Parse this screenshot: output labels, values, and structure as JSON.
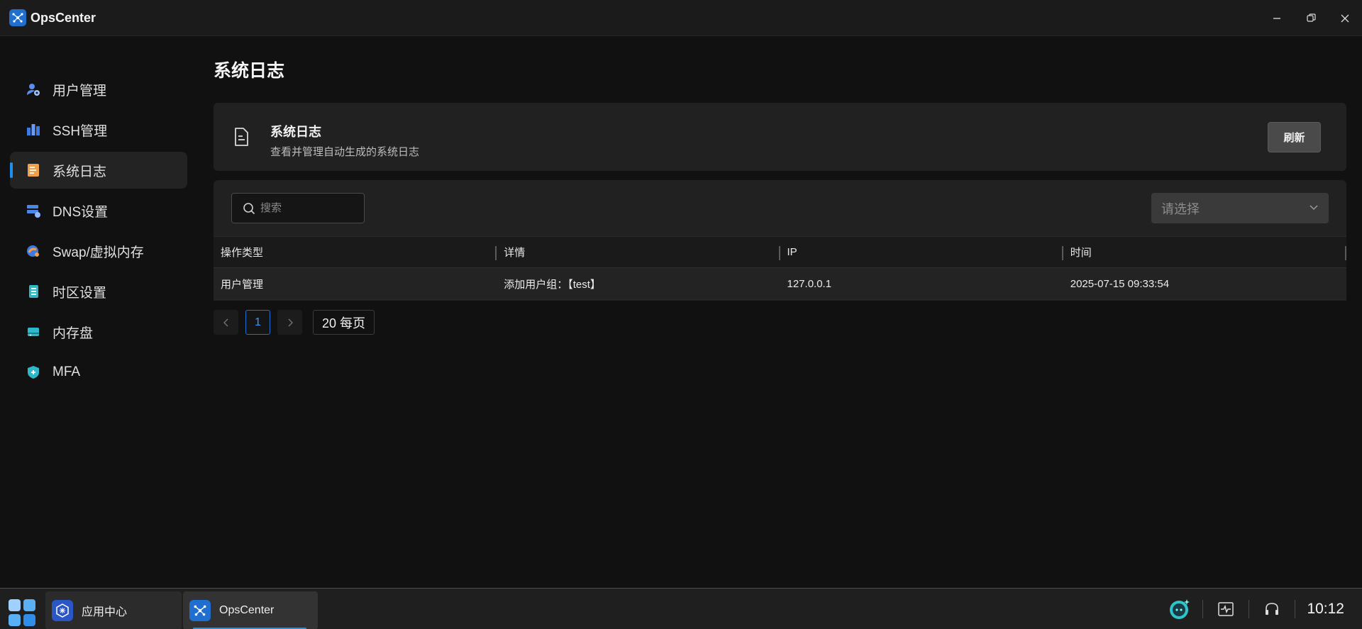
{
  "app": {
    "title": "OpsCenter"
  },
  "sidebar": {
    "items": [
      {
        "label": "用户管理",
        "icon": "user-gear-icon"
      },
      {
        "label": "SSH管理",
        "icon": "server-bars-icon"
      },
      {
        "label": "系统日志",
        "icon": "log-book-icon",
        "active": true
      },
      {
        "label": "DNS设置",
        "icon": "dns-server-icon"
      },
      {
        "label": "Swap/虚拟内存",
        "icon": "swap-memory-icon"
      },
      {
        "label": "时区设置",
        "icon": "timezone-icon"
      },
      {
        "label": "内存盘",
        "icon": "ram-disk-icon"
      },
      {
        "label": "MFA",
        "icon": "shield-icon"
      }
    ]
  },
  "main": {
    "page_title": "系统日志",
    "card": {
      "title": "系统日志",
      "description": "查看并管理自动生成的系统日志",
      "refresh_label": "刷新"
    },
    "toolbar": {
      "search_placeholder": "搜索",
      "select_placeholder": "请选择"
    },
    "table": {
      "columns": [
        "操作类型",
        "详情",
        "IP",
        "时间"
      ],
      "rows": [
        [
          "用户管理",
          "添加用户组：【test】",
          "127.0.0.1",
          "2025-07-15 09:33:54"
        ]
      ]
    },
    "pagination": {
      "current_page": "1",
      "page_size_label": "20 每页"
    }
  },
  "taskbar": {
    "apps": [
      {
        "label": "应用中心"
      },
      {
        "label": "OpsCenter",
        "active": true
      }
    ],
    "clock": "10:12"
  },
  "colors": {
    "accent": "#1f8ef1",
    "background": "#111111",
    "card": "#212121"
  }
}
